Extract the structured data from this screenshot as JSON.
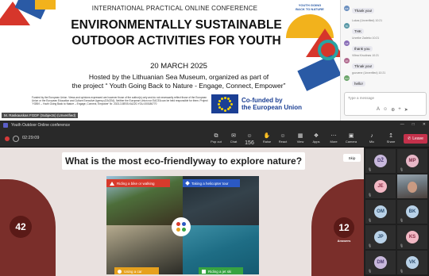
{
  "slide": {
    "conference": "INTERNATIONAL PRACTICAL ONLINE CONFERENCE",
    "logo_text": "YOUTH GOING BACK TO NATURE",
    "title_line1": "ENVIRONMENTALLY SUSTAINABLE",
    "title_line2": "OUTDOOR ACTIVITIES FOR YOUTH",
    "date": "20 MARCH 2025",
    "hosted_line1": "Hosted by the Lithuanian Sea Museum, organized as part of",
    "hosted_line2": "the project “ Youth Going Back to Nature - Engage, Connect, Empower”",
    "disclaimer": "Funded by the European Union. Views and opinions expressed are however those of the author(s) only and do not necessarily reflect those of the European Union or the European Education and Culture Executive Agency (EACEA). Neither the European Union nor EACEA can be held responsible for them. Project 'YGBN' – Youth Going Back to Nature – Engage, Connect, Empower' Nr. 2023-3-BE05-KA220-YOU-000186770",
    "eu_line1": "Co-funded by",
    "eu_line2": "the European Union",
    "presenter": "M. Raskauskas FGDF (Subjects) (Unverified)"
  },
  "chat": {
    "messages": [
      {
        "initials": "MK",
        "author": "",
        "time": "",
        "text": "Thank you!",
        "color": "#6a8fbf"
      },
      {
        "initials": "TK",
        "author": "Lukas (Unverified)",
        "time": "10:21",
        "text": "THK",
        "color": "#5b9aa8"
      },
      {
        "initials": "UZ",
        "author": "Urzeike Zadeko",
        "time": "10:21",
        "text": "thank you",
        "color": "#8a6fb8"
      },
      {
        "initials": "VK",
        "author": "Viltna Kirudinas",
        "time": "10:21",
        "text": "Thnak you!",
        "color": "#b06a8e"
      },
      {
        "initials": "GU",
        "author": "govuene (Unverified)",
        "time": "10:21",
        "text": "hello!",
        "color": "#6aa56a"
      }
    ],
    "input_placeholder": "Type a message"
  },
  "window": {
    "title": "Youth Outdoor Online conference",
    "minimize": "—",
    "maximize": "□",
    "close": "✕"
  },
  "toolbar": {
    "timer": "02:29:09",
    "buttons": [
      {
        "icon": "⧉",
        "label": "Pop out",
        "name": "popout"
      },
      {
        "icon": "✉",
        "label": "Chat",
        "name": "chat"
      },
      {
        "icon": "☺ 156",
        "label": "People",
        "name": "people"
      },
      {
        "icon": "✋",
        "label": "Raise",
        "name": "raise"
      },
      {
        "icon": "☺",
        "label": "React",
        "name": "react"
      },
      {
        "icon": "▦",
        "label": "View",
        "name": "view"
      },
      {
        "icon": "❖",
        "label": "Apps",
        "name": "apps"
      },
      {
        "icon": "⋯",
        "label": "More",
        "name": "more"
      },
      {
        "icon": "▣",
        "label": "Camera",
        "name": "camera"
      },
      {
        "icon": "♪",
        "label": "Mic",
        "name": "mic"
      },
      {
        "icon": "↥",
        "label": "Share",
        "name": "share"
      }
    ],
    "leave": "Leave"
  },
  "quiz": {
    "question_prefix": "What is the ",
    "question_bold": "most eco-friendly",
    "question_mid": " way",
    "question_suffix": " to explore nature?",
    "skip": "Skip",
    "timer": "42",
    "answers_count": "12",
    "answers_label": "Answers",
    "options": [
      {
        "label": "Riding a bike or walking",
        "color": "#d73a2c",
        "shape": "triangle"
      },
      {
        "label": "Taking a helicopter tour",
        "color": "#2b59c3",
        "shape": "diamond"
      },
      {
        "label": "Using a car",
        "color": "#e6a11e",
        "shape": "circle"
      },
      {
        "label": "Riding a jet ski",
        "color": "#37a341",
        "shape": "square"
      }
    ]
  },
  "participants": [
    {
      "initials": "DŽ",
      "bg": "#c8b8dc",
      "fg": "#4b3b70"
    },
    {
      "initials": "MP",
      "bg": "#e7b7c7",
      "fg": "#7a2e46"
    },
    {
      "initials": "JE",
      "bg": "#f2b8c4",
      "fg": "#8a2d44"
    },
    {
      "initials": "",
      "bg": "",
      "fg": ""
    },
    {
      "initials": "OM",
      "bg": "#b9d2e8",
      "fg": "#2d4d6e"
    },
    {
      "initials": "BK",
      "bg": "#b9d2e8",
      "fg": "#2d4d6e"
    },
    {
      "initials": "JP",
      "bg": "#b9d2e8",
      "fg": "#2d4d6e"
    },
    {
      "initials": "KS",
      "bg": "#f2b8c4",
      "fg": "#8a2d44"
    },
    {
      "initials": "DM",
      "bg": "#c8b8dc",
      "fg": "#4b3b70"
    },
    {
      "initials": "VK",
      "bg": "#b9d2e8",
      "fg": "#2d4d6e"
    }
  ]
}
